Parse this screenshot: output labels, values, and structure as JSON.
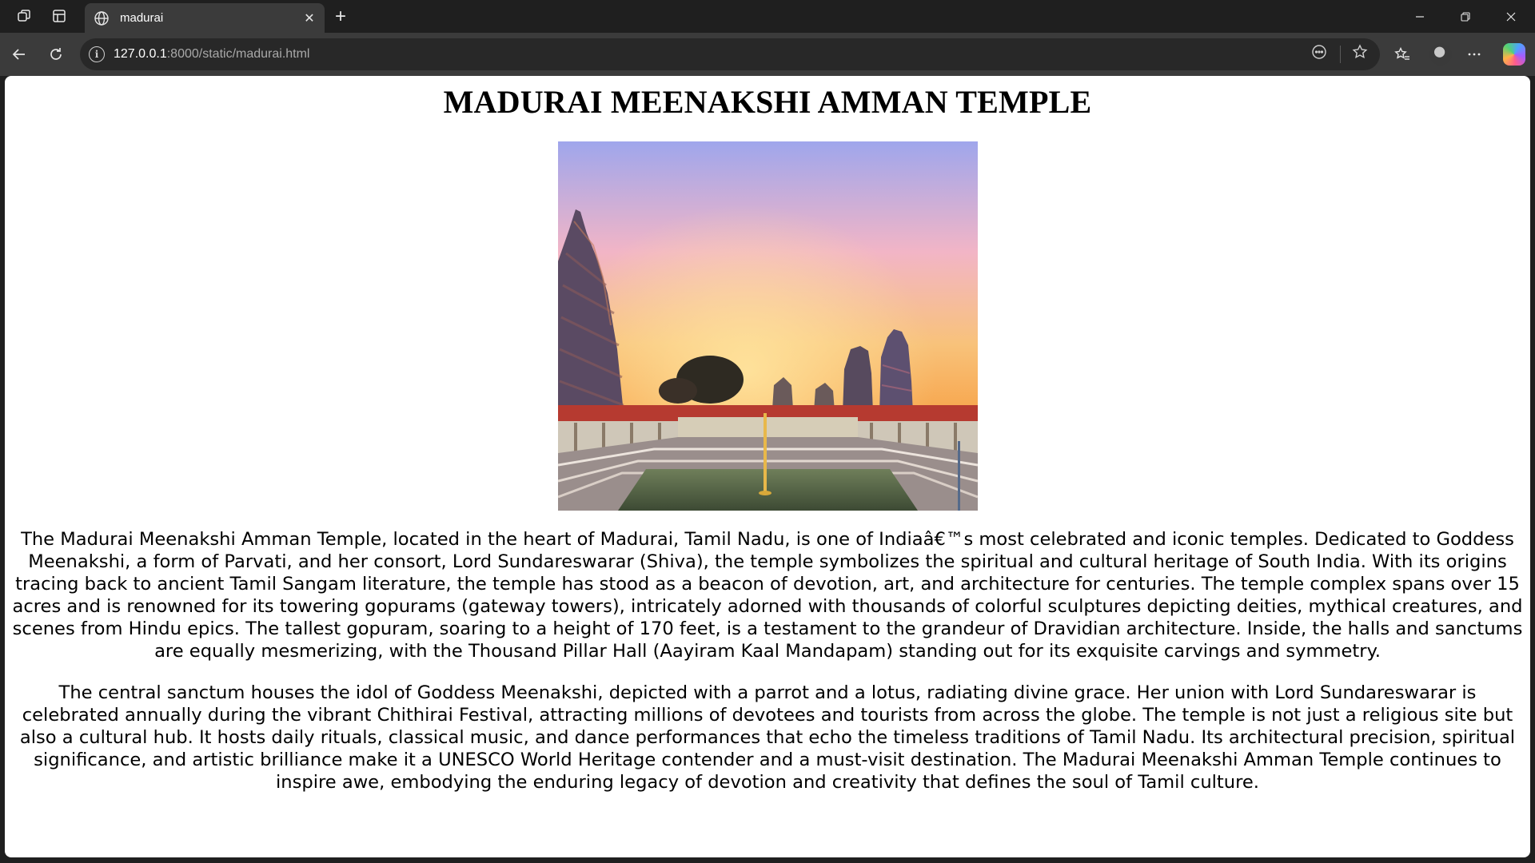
{
  "browser": {
    "tab": {
      "title": "madurai"
    },
    "address_bar": {
      "host": "127.0.0.1",
      "path": ":8000/static/madurai.html"
    },
    "icons": {
      "workspaces": "workspaces-icon",
      "vertical_tabs": "vertical-tabs-icon",
      "favicon": "globe-icon",
      "close_tab": "close-icon",
      "new_tab": "plus-icon",
      "back": "back-arrow-icon",
      "refresh": "refresh-icon",
      "site_info": "info-icon",
      "read_aloud": "read-aloud-icon",
      "favorite": "star-icon",
      "favorites": "favorites-icon",
      "profile": "profile-avatar",
      "more": "more-icon",
      "copilot": "copilot-icon",
      "minimize": "minimize-icon",
      "restore": "restore-icon",
      "close_window": "close-window-icon"
    }
  },
  "page": {
    "title": "MADURAI MEENAKSHI AMMAN TEMPLE",
    "paragraphs": [
      "The Madurai Meenakshi Amman Temple, located in the heart of Madurai, Tamil Nadu, is one of Indiaâ€™s most celebrated and iconic temples. Dedicated to Goddess Meenakshi, a form of Parvati, and her consort, Lord Sundareswarar (Shiva), the temple symbolizes the spiritual and cultural heritage of South India. With its origins tracing back to ancient Tamil Sangam literature, the temple has stood as a beacon of devotion, art, and architecture for centuries. The temple complex spans over 15 acres and is renowned for its towering gopurams (gateway towers), intricately adorned with thousands of colorful sculptures depicting deities, mythical creatures, and scenes from Hindu epics. The tallest gopuram, soaring to a height of 170 feet, is a testament to the grandeur of Dravidian architecture. Inside, the halls and sanctums are equally mesmerizing, with the Thousand Pillar Hall (Aayiram Kaal Mandapam) standing out for its exquisite carvings and symmetry.",
      "The central sanctum houses the idol of Goddess Meenakshi, depicted with a parrot and a lotus, radiating divine grace. Her union with Lord Sundareswarar is celebrated annually during the vibrant Chithirai Festival, attracting millions of devotees and tourists from across the globe. The temple is not just a religious site but also a cultural hub. It hosts daily rituals, classical music, and dance performances that echo the timeless traditions of Tamil Nadu. Its architectural precision, spiritual significance, and artistic brilliance make it a UNESCO World Heritage contender and a must-visit destination. The Madurai Meenakshi Amman Temple continues to inspire awe, embodying the enduring legacy of devotion and creativity that defines the soul of Tamil culture."
    ]
  }
}
